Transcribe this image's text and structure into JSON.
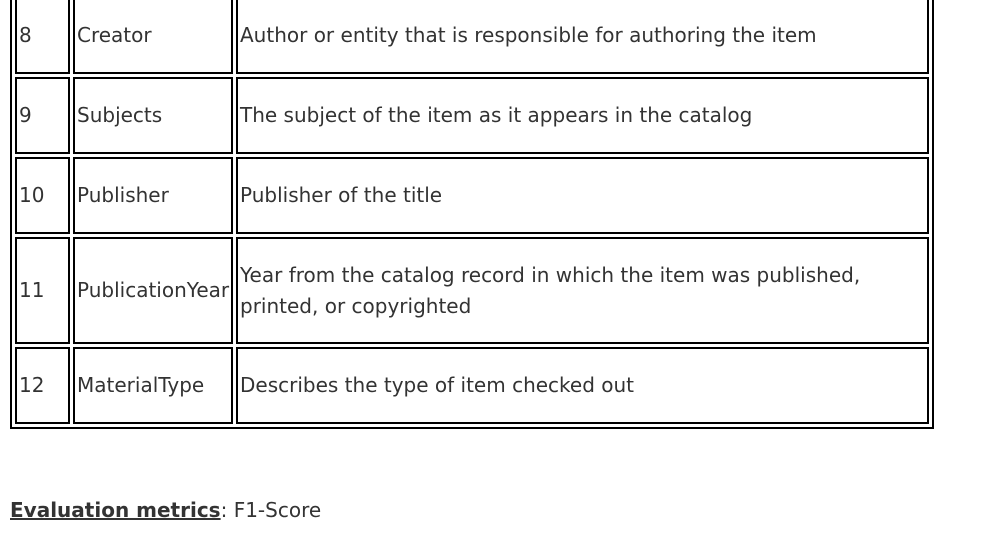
{
  "table": {
    "rows": [
      {
        "num": "8",
        "name": "Creator",
        "description": "Author or entity that is responsible for authoring the item"
      },
      {
        "num": "9",
        "name": "Subjects",
        "description": "The subject of the item as it appears in the catalog"
      },
      {
        "num": "10",
        "name": "Publisher",
        "description": "Publisher of the title"
      },
      {
        "num": "11",
        "name": "PublicationYear",
        "description": "Year from the catalog record in which the item was published, printed, or copyrighted"
      },
      {
        "num": "12",
        "name": "MaterialType",
        "description": "Describes the type of item checked out"
      }
    ]
  },
  "evaluation": {
    "label": "Evaluation metrics",
    "separator": ": ",
    "value": "F1-Score"
  }
}
